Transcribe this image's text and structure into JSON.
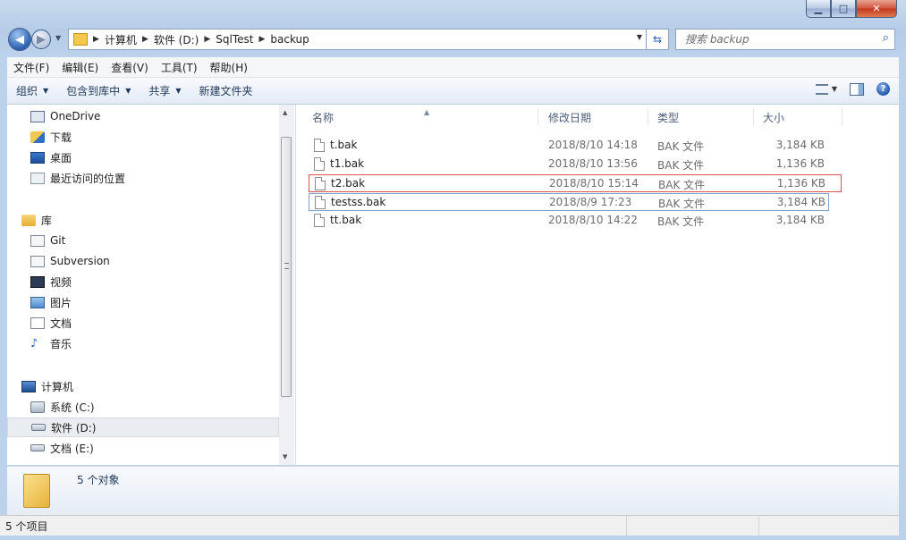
{
  "address": {
    "crumbs": [
      "计算机",
      "软件 (D:)",
      "SqlTest",
      "backup"
    ]
  },
  "search": {
    "placeholder": "搜索 backup"
  },
  "menu": [
    "文件(F)",
    "编辑(E)",
    "查看(V)",
    "工具(T)",
    "帮助(H)"
  ],
  "toolbar": {
    "organize": "组织",
    "include_library": "包含到库中",
    "share": "共享",
    "new_folder": "新建文件夹"
  },
  "nav": {
    "favorites": [
      "OneDrive",
      "下载",
      "桌面",
      "最近访问的位置"
    ],
    "libraries_header": "库",
    "libraries": [
      "Git",
      "Subversion",
      "视频",
      "图片",
      "文档",
      "音乐"
    ],
    "computer_header": "计算机",
    "drives": [
      "系统 (C:)",
      "软件 (D:)",
      "文档 (E:)"
    ]
  },
  "columns": {
    "name": "名称",
    "date": "修改日期",
    "type": "类型",
    "size": "大小"
  },
  "files": [
    {
      "name": "t.bak",
      "date": "2018/8/10 14:18",
      "type": "BAK 文件",
      "size": "3,184 KB"
    },
    {
      "name": "t1.bak",
      "date": "2018/8/10 13:56",
      "type": "BAK 文件",
      "size": "1,136 KB"
    },
    {
      "name": "t2.bak",
      "date": "2018/8/10 15:14",
      "type": "BAK 文件",
      "size": "1,136 KB"
    },
    {
      "name": "testss.bak",
      "date": "2018/8/9 17:23",
      "type": "BAK 文件",
      "size": "3,184 KB"
    },
    {
      "name": "tt.bak",
      "date": "2018/8/10 14:22",
      "type": "BAK 文件",
      "size": "3,184 KB"
    }
  ],
  "details": {
    "count": "5 个对象"
  },
  "status": {
    "text": "5 个项目"
  },
  "colors": {
    "highlight_red": "#e05252",
    "focus_blue": "#7da2ce",
    "folder": "#f3c84d"
  }
}
